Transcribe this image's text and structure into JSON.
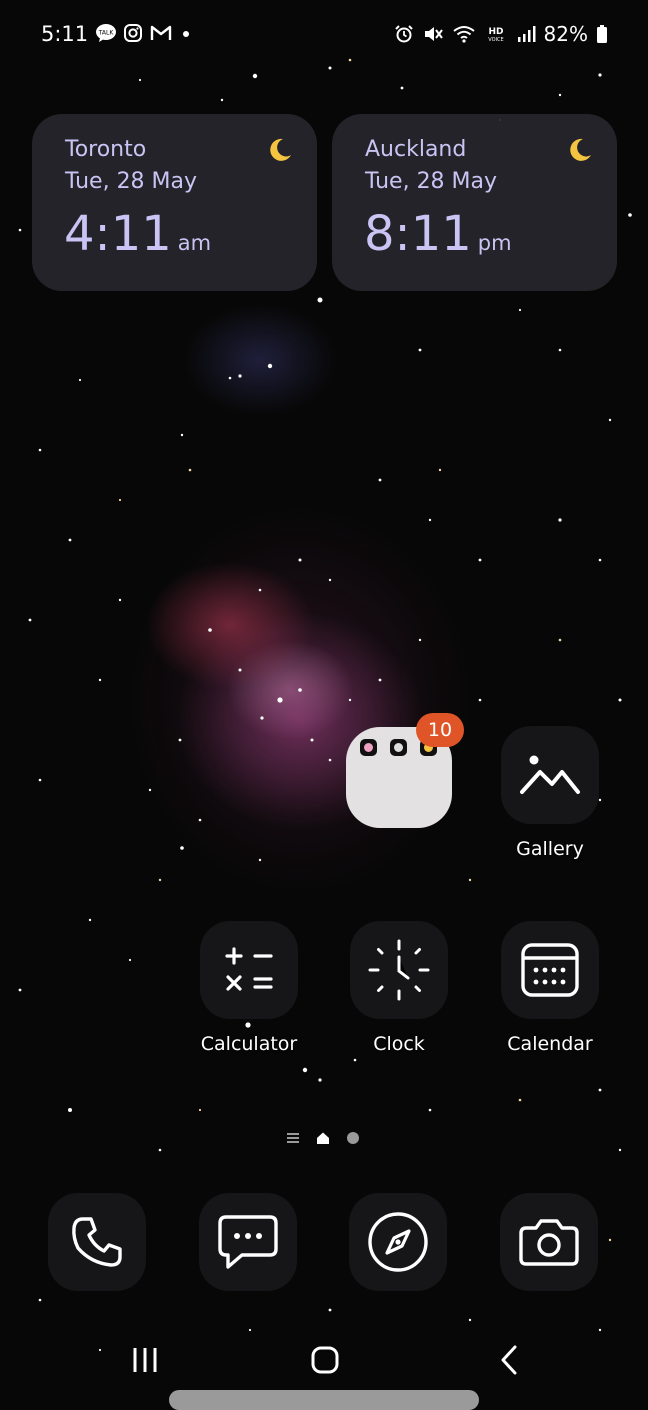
{
  "status_bar": {
    "time": "5:11",
    "battery": "82%",
    "left_icons": [
      "talk-icon",
      "instagram-icon",
      "gmail-icon",
      "dot-icon"
    ],
    "right_icons": [
      "alarm-icon",
      "mute-icon",
      "wifi-icon",
      "hd-voice-icon",
      "signal-icon",
      "battery-icon"
    ],
    "hd_top": "HD",
    "hd_bottom": "VOICE"
  },
  "widgets": [
    {
      "city": "Toronto",
      "date": "Tue, 28 May",
      "time": "4:11",
      "ampm": "am",
      "icon": "moon-icon"
    },
    {
      "city": "Auckland",
      "date": "Tue, 28 May",
      "time": "8:11",
      "ampm": "pm",
      "icon": "moon-icon"
    }
  ],
  "folder": {
    "badge": "10"
  },
  "apps": {
    "gallery": "Gallery",
    "calculator": "Calculator",
    "clock": "Clock",
    "calendar": "Calendar"
  },
  "dock": [
    "phone-icon",
    "messages-icon",
    "browser-icon",
    "camera-icon"
  ],
  "colors": {
    "widget_text": "#c9c4f3",
    "badge": "#e05527",
    "tile": "#161618"
  }
}
